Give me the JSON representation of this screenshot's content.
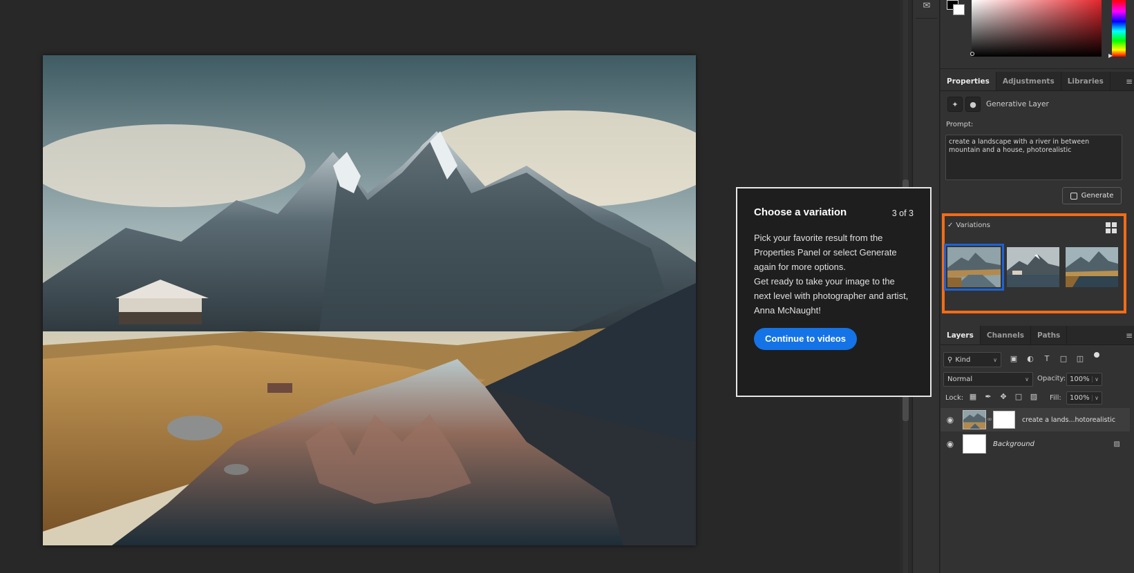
{
  "toolstrip": {
    "comment_icon": "comment-icon"
  },
  "panel_tabs": [
    {
      "label": "Properties",
      "active": true
    },
    {
      "label": "Adjustments",
      "active": false
    },
    {
      "label": "Libraries",
      "active": false
    }
  ],
  "properties": {
    "layer_type": "Generative Layer",
    "prompt_label": "Prompt:",
    "prompt_text": "create a landscape with a river in between mountain and a house, photorealistic",
    "generate_label": "Generate",
    "variations_label": "Variations",
    "variations_check": "✓",
    "selected_variation_index": 0,
    "highlight_color": "#f46c16",
    "selection_color": "#1d63d6"
  },
  "layers_tabs": [
    {
      "label": "Layers",
      "active": true
    },
    {
      "label": "Channels",
      "active": false
    },
    {
      "label": "Paths",
      "active": false
    }
  ],
  "layers_panel": {
    "kind_label": "Kind",
    "blend_mode": "Normal",
    "opacity_label": "Opacity:",
    "opacity_value": "100%",
    "lock_label": "Lock:",
    "fill_label": "Fill:",
    "fill_value": "100%",
    "layers": [
      {
        "name": "create a lands...hotorealistic",
        "active": true
      },
      {
        "name": "Background",
        "active": false
      }
    ]
  },
  "modal": {
    "title": "Choose a variation",
    "step": "3 of 3",
    "body_line1": "Pick your favorite result from the Properties Panel or select Generate again for more options.",
    "body_line2": "Get ready to take your image to the next level with photographer and artist, Anna McNaught!",
    "button_label": "Continue to videos",
    "button_color": "#1473e6"
  }
}
